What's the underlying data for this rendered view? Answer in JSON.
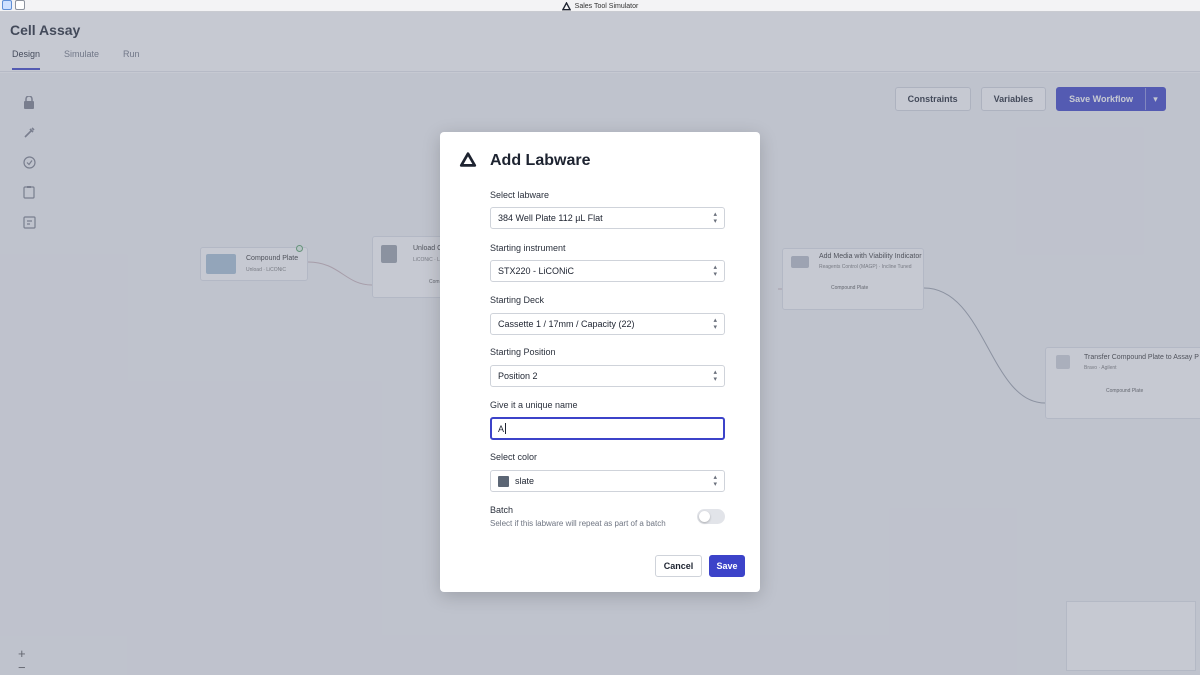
{
  "window": {
    "title": "Sales Tool Simulator"
  },
  "app": {
    "title": "Cell Assay",
    "tabs": [
      {
        "label": "Design",
        "active": true
      },
      {
        "label": "Simulate",
        "active": false
      },
      {
        "label": "Run",
        "active": false
      }
    ],
    "toolbar": {
      "constraints_label": "Constraints",
      "variables_label": "Variables",
      "save_workflow_label": "Save Workflow"
    },
    "sidebar_icons": [
      "lock-icon",
      "pipette-icon",
      "check-circle-icon",
      "clipboard-icon",
      "note-icon"
    ],
    "nodes": [
      {
        "title": "Compound Plate",
        "subtitle": "Unload · LiCONiC"
      },
      {
        "title": "Unload C",
        "subtitle": "LiCONiC · LI",
        "body": "Com"
      },
      {
        "title": "Add Media with Viability Indicator",
        "subtitle": "Reagents Control (MAGP) · Incline Tuned",
        "body": "Compound Plate"
      },
      {
        "title": "Transfer Compound Plate to Assay P",
        "subtitle": "Bravo · Agilent",
        "body": "Compound Plate"
      }
    ],
    "zoom": {
      "in": "+",
      "out": "−"
    }
  },
  "modal": {
    "title": "Add Labware",
    "fields": {
      "labware": {
        "label": "Select labware",
        "value": "384 Well Plate 112 µL Flat"
      },
      "instrument": {
        "label": "Starting instrument",
        "value": "STX220 - LiCONiC"
      },
      "deck": {
        "label": "Starting Deck",
        "value": "Cassette 1 / 17mm / Capacity (22)"
      },
      "position": {
        "label": "Starting Position",
        "value": "Position 2"
      },
      "name": {
        "label": "Give it a unique name",
        "value": "A"
      },
      "color": {
        "label": "Select color",
        "value": "slate",
        "swatch": "#5c6675"
      }
    },
    "batch": {
      "label": "Batch",
      "description": "Select if this labware will repeat as part of a batch",
      "enabled": false
    },
    "cancel_label": "Cancel",
    "save_label": "Save"
  },
  "colors": {
    "accent": "#3c43c9",
    "overlay": "rgba(118,126,148,0.42)"
  }
}
